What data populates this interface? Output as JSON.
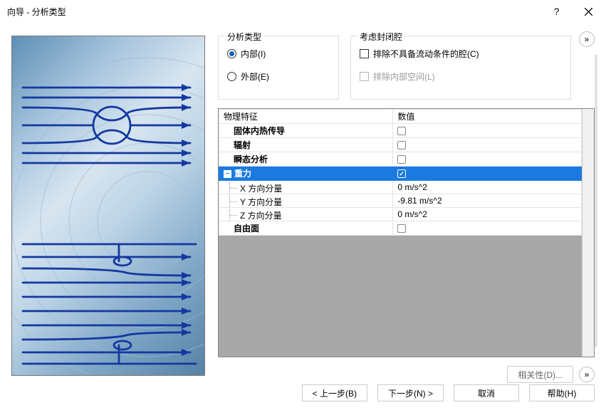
{
  "window": {
    "title": "向导 - 分析类型"
  },
  "group_analysis": {
    "legend": "分析类型",
    "internal": "内部(I)",
    "external": "外部(E)",
    "selected": "internal"
  },
  "group_cavity": {
    "legend": "考虑封闭腔",
    "exclude_noflow": "排除不具备流动条件的腔(C)",
    "exclude_inner": "排除内部空间(L)"
  },
  "table": {
    "col_feature": "物理特征",
    "col_value": "数值",
    "rows": {
      "solid_heat": "固体内热传导",
      "radiation": "辐射",
      "transient": "瞬态分析",
      "gravity": "重力",
      "x_comp": "X 方向分量",
      "y_comp": "Y 方向分量",
      "z_comp": "Z 方向分量",
      "free_surface": "自由面"
    },
    "values": {
      "x": "0 m/s^2",
      "y": "-9.81 m/s^2",
      "z": "0 m/s^2"
    }
  },
  "buttons": {
    "related": "相关性(D)...",
    "back": "< 上一步(B)",
    "next": "下一步(N) >",
    "cancel": "取消",
    "help": "帮助(H)"
  }
}
